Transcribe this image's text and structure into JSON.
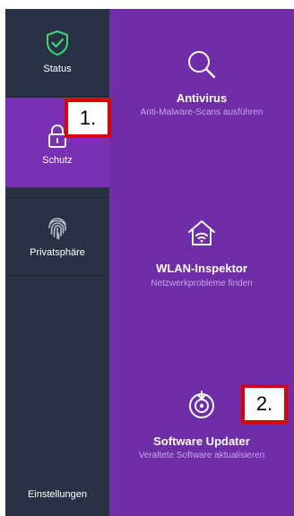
{
  "sidebar": {
    "items": [
      {
        "label": "Status",
        "icon": "shield-check-icon"
      },
      {
        "label": "Schutz",
        "icon": "lock-icon"
      },
      {
        "label": "Privatsphäre",
        "icon": "fingerprint-icon"
      }
    ],
    "settings_label": "Einstellungen"
  },
  "main": {
    "features": [
      {
        "title": "Antivirus",
        "subtitle": "Anti-Malware-Scans ausführen",
        "icon": "magnifier-icon"
      },
      {
        "title": "WLAN-Inspektor",
        "subtitle": "Netzwerkprobleme finden",
        "icon": "home-wifi-icon"
      },
      {
        "title": "Software Updater",
        "subtitle": "Veraltete Software aktualisieren",
        "icon": "updater-icon"
      }
    ]
  },
  "callouts": [
    "1.",
    "2."
  ],
  "colors": {
    "sidebar_bg": "#293245",
    "sidebar_active_bg": "#7a30b5",
    "main_bg": "#6f2da8",
    "status_green": "#3fd67a",
    "subtitle_text": "#c7a6e6",
    "callout_border": "#e00000"
  }
}
